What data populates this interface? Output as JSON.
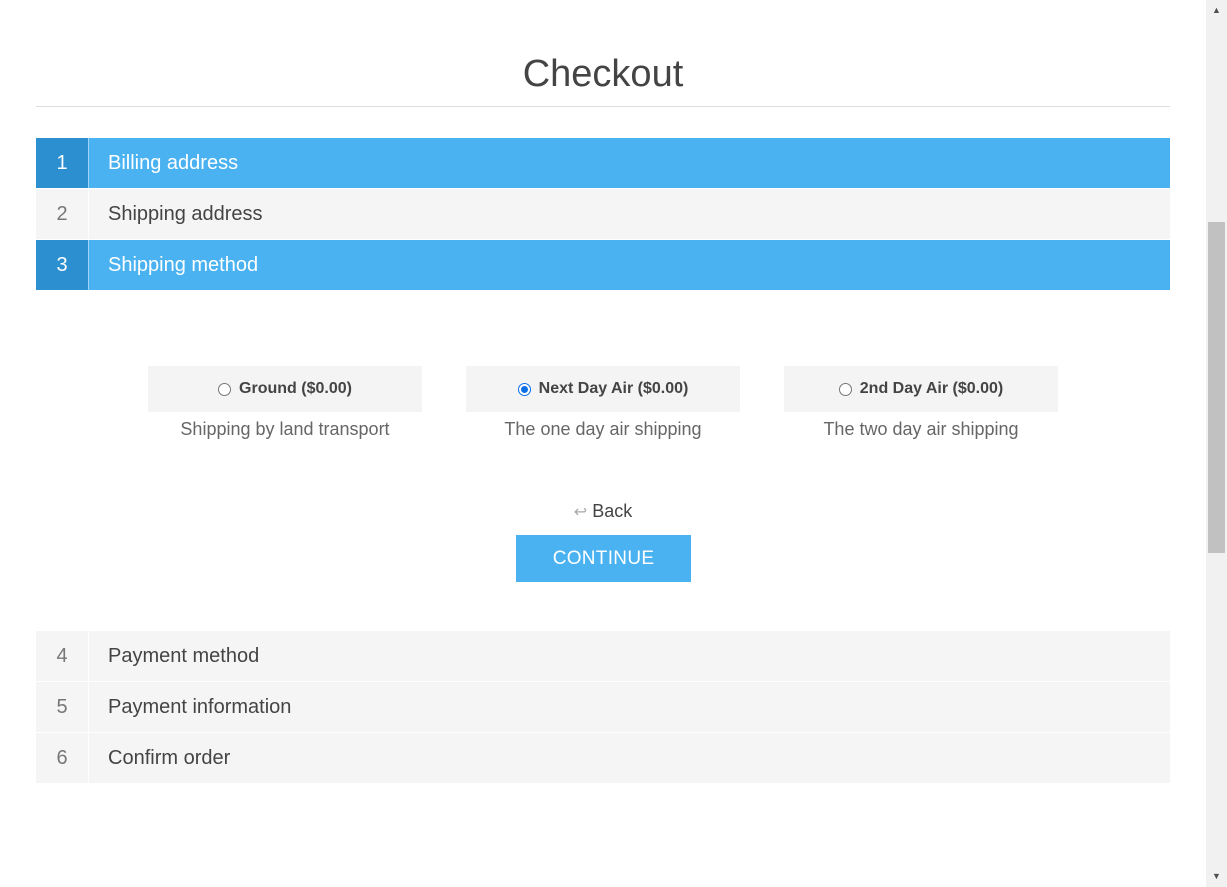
{
  "page": {
    "title": "Checkout"
  },
  "steps_top": [
    {
      "num": "1",
      "label": "Billing address"
    },
    {
      "num": "2",
      "label": "Shipping address"
    },
    {
      "num": "3",
      "label": "Shipping method"
    }
  ],
  "shipping": {
    "options": [
      {
        "label": "Ground ($0.00)",
        "description": "Shipping by land transport",
        "selected": false
      },
      {
        "label": "Next Day Air ($0.00)",
        "description": "The one day air shipping",
        "selected": true
      },
      {
        "label": "2nd Day Air ($0.00)",
        "description": "The two day air shipping",
        "selected": false
      }
    ],
    "back_label": "Back",
    "back_icon": "↩",
    "continue_label": "CONTINUE"
  },
  "steps_bottom": [
    {
      "num": "4",
      "label": "Payment method"
    },
    {
      "num": "5",
      "label": "Payment information"
    },
    {
      "num": "6",
      "label": "Confirm order"
    }
  ],
  "colors": {
    "accent": "#4ab2f1",
    "accent_dark": "#2b8fd0",
    "radio_selected": "#0b6fe8"
  }
}
